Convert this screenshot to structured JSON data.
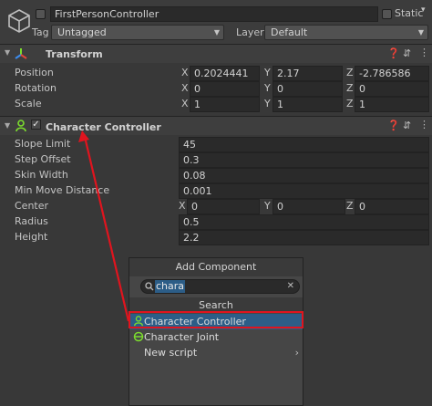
{
  "header": {
    "object_name": "FirstPersonController",
    "static_label": "Static",
    "tag_label": "Tag",
    "tag_value": "Untagged",
    "layer_label": "Layer",
    "layer_value": "Default"
  },
  "transform": {
    "title": "Transform",
    "rows": [
      {
        "label": "Position",
        "x": "0.2024441",
        "y": "2.17",
        "z": "-2.786586"
      },
      {
        "label": "Rotation",
        "x": "0",
        "y": "0",
        "z": "0"
      },
      {
        "label": "Scale",
        "x": "1",
        "y": "1",
        "z": "1"
      }
    ]
  },
  "character_controller": {
    "title": "Character Controller",
    "rows": [
      {
        "label": "Slope Limit",
        "value": "45"
      },
      {
        "label": "Step Offset",
        "value": "0.3"
      },
      {
        "label": "Skin Width",
        "value": "0.08"
      },
      {
        "label": "Min Move Distance",
        "value": "0.001"
      },
      {
        "label": "Radius",
        "value": "0.5"
      },
      {
        "label": "Height",
        "value": "2.2"
      }
    ],
    "center": {
      "label": "Center",
      "x": "0",
      "y": "0",
      "z": "0"
    }
  },
  "axes": {
    "x": "X",
    "y": "Y",
    "z": "Z"
  },
  "add_component": {
    "title": "Add Component",
    "search_value": "chara",
    "section_label": "Search",
    "items": [
      {
        "label": "Character Controller",
        "icon": "character-controller-icon"
      },
      {
        "label": "Character Joint",
        "icon": "character-joint-icon"
      },
      {
        "label": "New script",
        "icon": "none"
      }
    ]
  },
  "colors": {
    "highlight_border": "#e0141e",
    "selection": "#2c5d87",
    "icon_green": "#7cdc2e"
  }
}
